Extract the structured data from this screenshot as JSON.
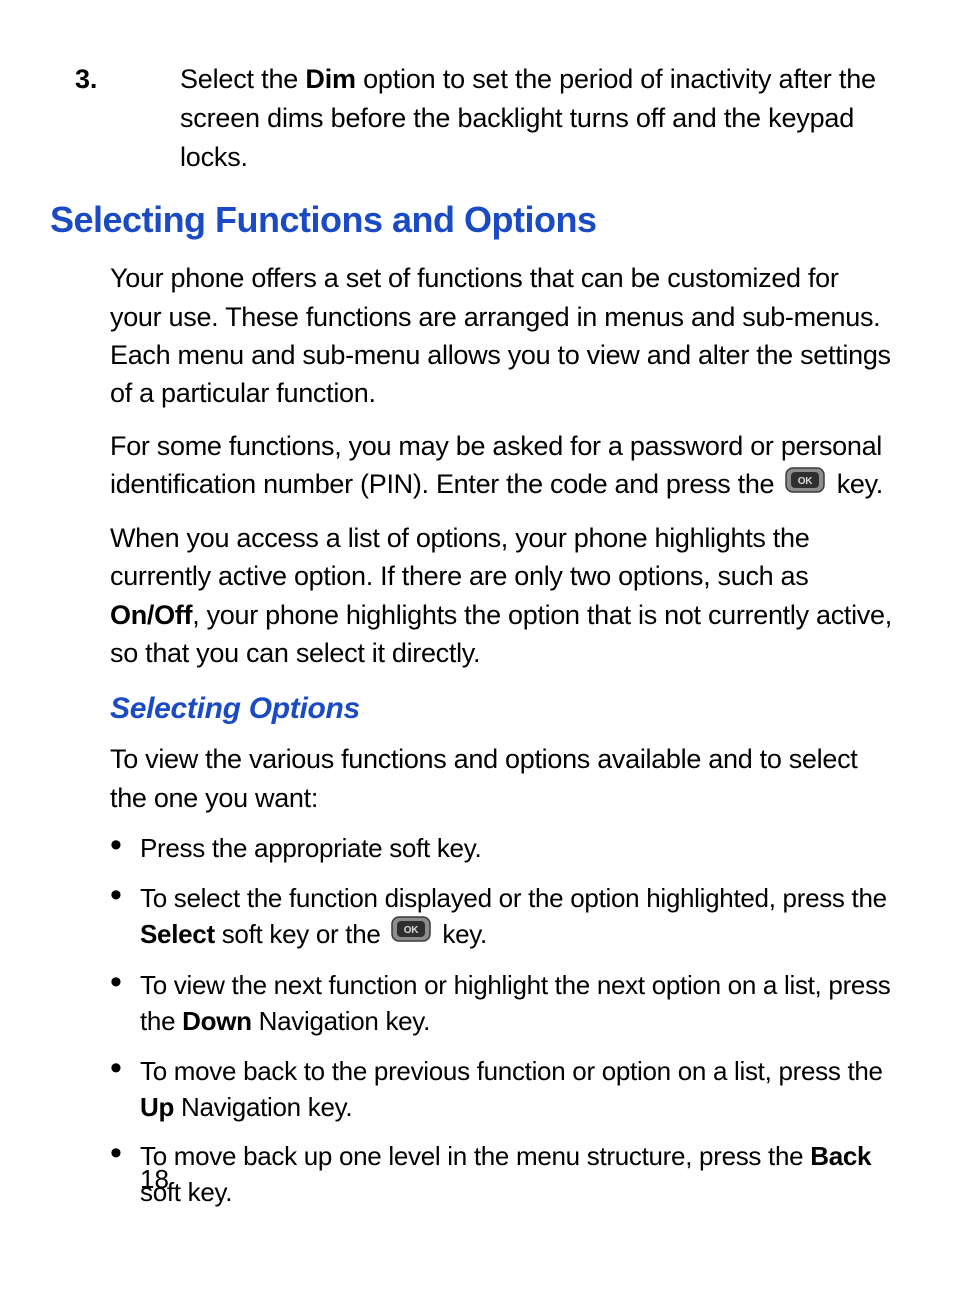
{
  "step3": {
    "marker": "3.",
    "prefix": "Select the ",
    "bold1": "Dim",
    "suffix": " option to set the period of inactivity after the screen dims before the backlight turns off and the keypad locks."
  },
  "section_title": "Selecting Functions and Options",
  "para1": "Your phone offers a set of functions that can be customized for your use. These functions are arranged in menus and sub-menus. Each menu and sub-menu allows you to view and alter the settings of a particular function.",
  "para2": {
    "prefix": "For some functions, you may be asked for a password or personal identification number (PIN). Enter the code and press the ",
    "suffix": " key."
  },
  "para3": {
    "prefix": "When you access a list of options, your phone highlights the currently active option. If there are only two options, such as ",
    "bold1": "On/Off",
    "suffix": ", your phone highlights the option that is not currently active, so that you can select it directly."
  },
  "sub_title": "Selecting Options",
  "para4": "To view the various functions and options available and to select the one you want:",
  "bullets": {
    "b1": "Press the appropriate soft key.",
    "b2": {
      "prefix": "To select the function displayed or the option highlighted, press the ",
      "bold1": "Select",
      "mid": " soft key or the ",
      "suffix": " key."
    },
    "b3": {
      "prefix": "To view the next function or highlight the next option on a list, press the ",
      "bold1": "Down",
      "suffix": " Navigation key."
    },
    "b4": {
      "prefix": "To move back to the previous function or option on a list, press the ",
      "bold1": "Up",
      "suffix": " Navigation key."
    },
    "b5": {
      "prefix": "To move back up one level in the menu structure, press the ",
      "bold1": "Back",
      "suffix": " soft key."
    }
  },
  "page_number": "18",
  "icons": {
    "ok_key": "ok-key-icon"
  }
}
